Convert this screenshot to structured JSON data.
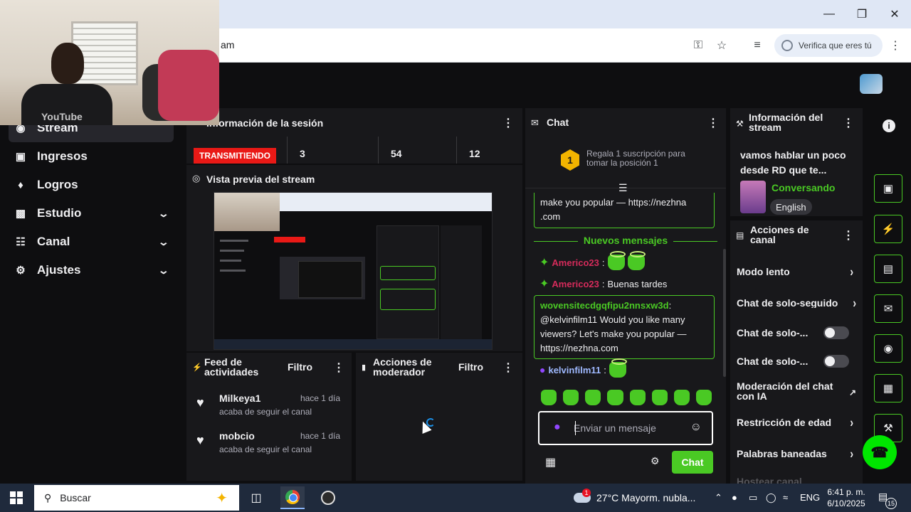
{
  "browser": {
    "url_fragment": "am",
    "verify_label": "Verifica que eres tú",
    "icons": [
      "key-icon",
      "star-icon",
      "playlist-icon",
      "more-icon"
    ]
  },
  "webcam": {
    "watermark": "YouTube"
  },
  "sidebar": {
    "items": [
      {
        "label": "Stream",
        "icon": "stream-icon",
        "expandable": false,
        "active": true
      },
      {
        "label": "Ingresos",
        "icon": "income-icon",
        "expandable": false
      },
      {
        "label": "Logros",
        "icon": "trophy-icon",
        "expandable": false
      },
      {
        "label": "Estudio",
        "icon": "studio-icon",
        "expandable": true
      },
      {
        "label": "Canal",
        "icon": "channel-icon",
        "expandable": true
      },
      {
        "label": "Ajustes",
        "icon": "gear-icon",
        "expandable": true
      }
    ]
  },
  "session": {
    "title": "Información de la sesión",
    "status": "TRANSMITIENDO",
    "stats": [
      "3",
      "54",
      "12"
    ]
  },
  "preview": {
    "title": "Vista previa del stream"
  },
  "feed": {
    "title": "Feed de actividades",
    "filter": "Filtro",
    "items": [
      {
        "name": "Milkeya1",
        "time": "hace 1 día",
        "desc": "acaba de seguir el canal"
      },
      {
        "name": "mobcio",
        "time": "hace 1 día",
        "desc": "acaba de seguir el canal"
      }
    ]
  },
  "mod_actions": {
    "title": "Acciones de moderador",
    "filter": "Filtro"
  },
  "chat": {
    "title": "Chat",
    "sub_promo_rank": "1",
    "sub_promo": "Regala 1 suscripción para tomar la posición 1",
    "msg1_text": "make you popular — https://nezhna .com",
    "new_messages": "Nuevos mensajes",
    "msg2_user": "Americo23",
    "msg3_user": "Americo23",
    "msg3_text": "Buenas tardes",
    "msg4_user": "wovensitecdgqfipu2nnsxw3d",
    "msg4_text": "@kelvinfilm11 Would you like many viewers? Let's make you popular — https://nezhna.com",
    "msg5_user": "kelvinfilm11",
    "input_placeholder": "Enviar un mensaje",
    "send_label": "Chat",
    "colors": {
      "accent": "#4ac924",
      "red_user": "#d62b5b"
    }
  },
  "stream_info": {
    "title": "Información del stream",
    "stream_title": "vamos hablar un poco desde RD que te...",
    "category": "Conversando",
    "tag": "English"
  },
  "channel_actions": {
    "title": "Acciones de canal",
    "items": [
      {
        "label": "Modo lento",
        "control": "chevron"
      },
      {
        "label": "Chat de solo-seguido",
        "control": "chevron"
      },
      {
        "label": "Chat de solo-...",
        "control": "toggle",
        "on": false
      },
      {
        "label": "Chat de solo-...",
        "control": "toggle",
        "on": false
      },
      {
        "label": "Moderación del chat con IA",
        "control": "external"
      },
      {
        "label": "Restricción de edad",
        "control": "chevron"
      },
      {
        "label": "Palabras baneadas",
        "control": "chevron"
      },
      {
        "label": "Hostear canal",
        "control": "none"
      }
    ]
  },
  "taskbar": {
    "search_label": "Buscar",
    "weather": "27°C  Mayorm. nubla...",
    "weather_badge": "1",
    "lang": "ENG",
    "time": "6:41 p. m.",
    "date": "6/10/2025",
    "notification_count": "15"
  }
}
